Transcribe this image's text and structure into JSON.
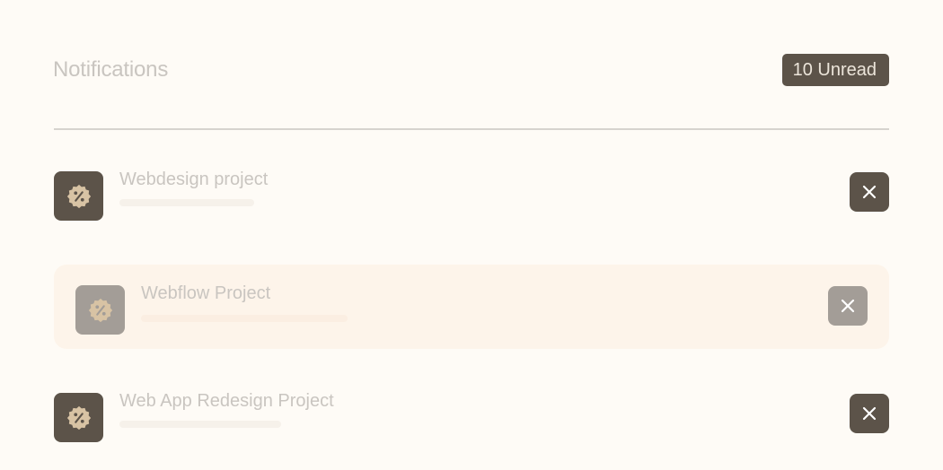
{
  "header": {
    "title": "Notifications",
    "unread_badge": "10 Unread"
  },
  "notifications": [
    {
      "title": "Webdesign project",
      "icon": "discount-badge-icon",
      "state": "default"
    },
    {
      "title": "Webflow Project",
      "icon": "discount-badge-icon",
      "state": "hover"
    },
    {
      "title": "Web App Redesign Project",
      "icon": "discount-badge-icon",
      "state": "default"
    }
  ],
  "colors": {
    "background": "#fefbf6",
    "accent_dark": "#5c5349",
    "accent_muted": "#a39d97",
    "icon_fill": "#d8c3a4",
    "hover_row": "#fdf4ea",
    "text_muted": "#c9c5c0"
  }
}
